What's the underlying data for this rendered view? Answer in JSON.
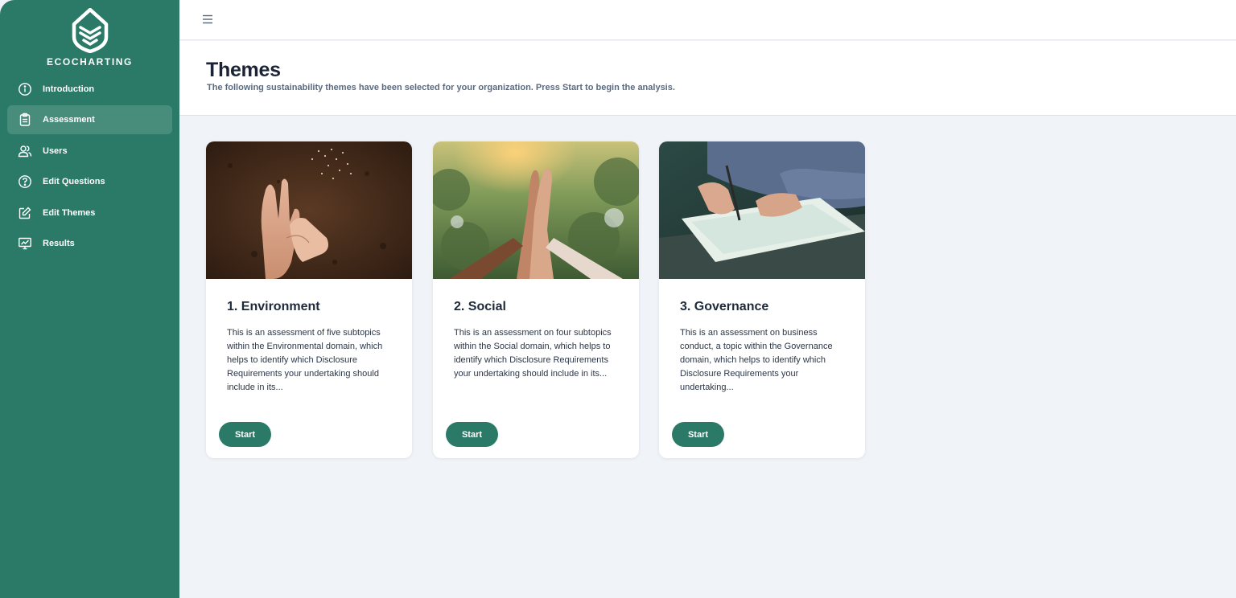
{
  "brand": {
    "name": "ECOCHARTING",
    "icon": "leaf-shield-logo",
    "color": "#2a7a67"
  },
  "topbar": {
    "menu_icon": "hamburger-icon"
  },
  "sidebar": {
    "items": [
      {
        "label": "Introduction",
        "icon": "info-icon",
        "active": false
      },
      {
        "label": "Assessment",
        "icon": "clipboard-icon",
        "active": true
      },
      {
        "label": "Users",
        "icon": "users-icon",
        "active": false
      },
      {
        "label": "Edit Questions",
        "icon": "question-icon",
        "active": false
      },
      {
        "label": "Edit Themes",
        "icon": "edit-icon",
        "active": false
      },
      {
        "label": "Results",
        "icon": "presentation-chart-icon",
        "active": false
      }
    ]
  },
  "page": {
    "title": "Themes",
    "subtitle": "The following sustainability themes have been selected for your organization. Press Start to begin the analysis."
  },
  "themes": [
    {
      "title": "1. Environment",
      "description": "This is an assessment of five subtopics within the Environmental domain, which helps to identify which Disclosure Requirements your undertaking should include in its...",
      "button": "Start",
      "image": "hands-holding-seeds-over-soil"
    },
    {
      "title": "2. Social",
      "description": "This is an assessment on four subtopics within the Social domain, which helps to identify which Disclosure Requirements your undertaking should include in its...",
      "button": "Start",
      "image": "hands-joined-high-five"
    },
    {
      "title": "3. Governance",
      "description": "This is an assessment on business conduct, a topic within the Governance domain, which helps to identify which Disclosure Requirements your undertaking...",
      "button": "Start",
      "image": "hand-signing-document"
    }
  ]
}
